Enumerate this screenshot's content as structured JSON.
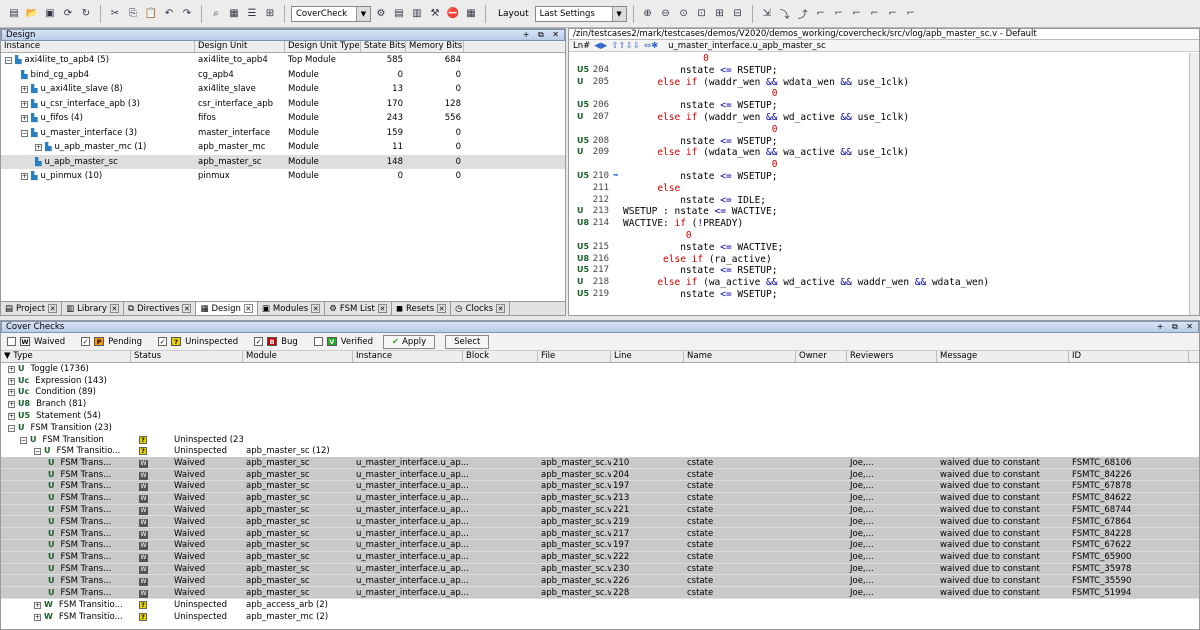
{
  "toolbar": {
    "coverage_combo": "CoverCheck",
    "layout_label": "Layout",
    "layout_value": "Last Settings"
  },
  "design": {
    "title": "Design",
    "columns": [
      "Instance",
      "Design Unit",
      "Design Unit Type",
      "State Bits",
      "Memory Bits"
    ],
    "rows": [
      {
        "instance": "axi4lite_to_apb4 (5)",
        "unit": "axi4lite_to_apb4",
        "type": "Top Module",
        "state": "585",
        "mem": "684"
      },
      {
        "instance": "bind_cg_apb4",
        "unit": "cg_apb4",
        "type": "Module",
        "state": "0",
        "mem": "0"
      },
      {
        "instance": "u_axi4lite_slave (8)",
        "unit": "axi4lite_slave",
        "type": "Module",
        "state": "13",
        "mem": "0"
      },
      {
        "instance": "u_csr_interface_apb (3)",
        "unit": "csr_interface_apb",
        "type": "Module",
        "state": "170",
        "mem": "128"
      },
      {
        "instance": "u_fifos (4)",
        "unit": "fifos",
        "type": "Module",
        "state": "243",
        "mem": "556"
      },
      {
        "instance": "u_master_interface (3)",
        "unit": "master_interface",
        "type": "Module",
        "state": "159",
        "mem": "0"
      },
      {
        "instance": "u_apb_master_mc (1)",
        "unit": "apb_master_mc",
        "type": "Module",
        "state": "11",
        "mem": "0"
      },
      {
        "instance": "u_apb_master_sc",
        "unit": "apb_master_sc",
        "type": "Module",
        "state": "148",
        "mem": "0"
      },
      {
        "instance": "u_pinmux (10)",
        "unit": "pinmux",
        "type": "Module",
        "state": "0",
        "mem": "0"
      }
    ],
    "tabs": [
      "Project",
      "Library",
      "Directives",
      "Design",
      "Modules",
      "FSM List",
      "Resets",
      "Clocks"
    ]
  },
  "source": {
    "path": "/zin/testcases2/mark/testcases/demos/V2020/demos_working/covercheck/src/vlog/apb_master_sc.v - Default",
    "ln_label": "Ln#",
    "scope": "u_master_interface.u_apb_master_sc",
    "lines": [
      {
        "g": "",
        "n": "",
        "t": "              0",
        "z": true
      },
      {
        "g": "U5",
        "n": "204",
        "t": "          nstate <= RSETUP;"
      },
      {
        "g": "U",
        "n": "205",
        "t": "      else if (waddr_wen && wdata_wen && use_1clk)"
      },
      {
        "g": "",
        "n": "",
        "t": "                          0",
        "z": true
      },
      {
        "g": "U5",
        "n": "206",
        "t": "          nstate <= WSETUP;"
      },
      {
        "g": "U",
        "n": "207",
        "t": "      else if (waddr_wen && wd_active && use_1clk)"
      },
      {
        "g": "",
        "n": "",
        "t": "                          0",
        "z": true
      },
      {
        "g": "U5",
        "n": "208",
        "t": "          nstate <= WSETUP;"
      },
      {
        "g": "U",
        "n": "209",
        "t": "      else if (wdata_wen && wa_active && use_1clk)"
      },
      {
        "g": "",
        "n": "",
        "t": "                          0",
        "z": true
      },
      {
        "g": "U5",
        "n": "210",
        "t": "          nstate <= WSETUP;",
        "a": true
      },
      {
        "g": "",
        "n": "211",
        "t": "      else"
      },
      {
        "g": "",
        "n": "212",
        "t": "          nstate <= IDLE;"
      },
      {
        "g": "U",
        "n": "213",
        "t": "WSETUP : nstate <= WACTIVE;"
      },
      {
        "g": "U8",
        "n": "214",
        "t": "WACTIVE: if (!PREADY)"
      },
      {
        "g": "",
        "n": "",
        "t": "           0",
        "z": true
      },
      {
        "g": "U5",
        "n": "215",
        "t": "          nstate <= WACTIVE;"
      },
      {
        "g": "U8",
        "n": "216",
        "t": "       else if (ra_active)"
      },
      {
        "g": "U5",
        "n": "217",
        "t": "          nstate <= RSETUP;"
      },
      {
        "g": "U",
        "n": "218",
        "t": "      else if (wa_active && wd_active && waddr_wen && wdata_wen)"
      },
      {
        "g": "U5",
        "n": "219",
        "t": "          nstate <= WSETUP;"
      }
    ]
  },
  "cover": {
    "title": "Cover Checks",
    "filters": [
      "Waived",
      "Pending",
      "Uninspected",
      "Bug",
      "Verified"
    ],
    "apply_label": "Apply",
    "select_label": "Select",
    "columns": [
      "Type",
      "Status",
      "Module",
      "Instance",
      "Block",
      "File",
      "Line",
      "Name",
      "Owner",
      "Reviewers",
      "Message",
      "ID"
    ],
    "groups": [
      "Toggle (1736)",
      "Expression (143)",
      "Condition (89)",
      "Branch (81)",
      "Statement (54)",
      "FSM Transition (23)"
    ],
    "sub1": {
      "type": "FSM Transition",
      "status": "Uninspected (23"
    },
    "sub2": {
      "type": "FSM Transitio...",
      "status": "Uninspected",
      "module": "apb_master_sc (12)"
    },
    "rows": [
      {
        "line": "210",
        "id": "FSMTC_68106"
      },
      {
        "line": "204",
        "id": "FSMTC_84226"
      },
      {
        "line": "197",
        "id": "FSMTC_67878"
      },
      {
        "line": "213",
        "id": "FSMTC_84622"
      },
      {
        "line": "221",
        "id": "FSMTC_68744"
      },
      {
        "line": "219",
        "id": "FSMTC_67864"
      },
      {
        "line": "217",
        "id": "FSMTC_84228"
      },
      {
        "line": "197",
        "id": "FSMTC_67622"
      },
      {
        "line": "222",
        "id": "FSMTC_65900"
      },
      {
        "line": "230",
        "id": "FSMTC_35978"
      },
      {
        "line": "226",
        "id": "FSMTC_35590"
      },
      {
        "line": "228",
        "id": "FSMTC_51994"
      }
    ],
    "row_common": {
      "type": "FSM Trans...",
      "status": "Waived",
      "module": "apb_master_sc",
      "instance": "u_master_interface.u_ap...",
      "file": "apb_master_sc.v",
      "name": "cstate",
      "reviewers": "Joe,...",
      "message": "waived due to constant"
    },
    "tail": [
      {
        "type": "FSM Transitio...",
        "status": "Uninspected",
        "module": "apb_access_arb (2)"
      },
      {
        "type": "FSM Transitio...",
        "status": "Uninspected",
        "module": "apb_master_mc (2)"
      }
    ]
  }
}
